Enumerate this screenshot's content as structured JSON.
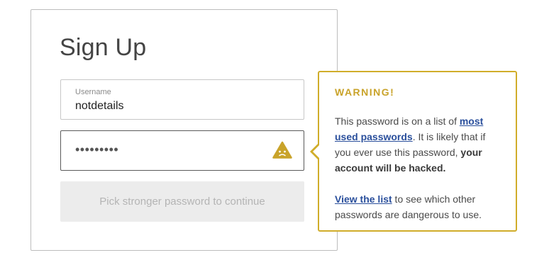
{
  "form": {
    "title": "Sign Up",
    "username": {
      "label": "Username",
      "value": "notdetails"
    },
    "password": {
      "masked_value": "•••••••••",
      "warning_icon": "warning-face-icon"
    },
    "submit_label": "Pick stronger password to continue"
  },
  "warning": {
    "heading": "WARNING!",
    "p1_before": "This password is on a list of ",
    "p1_link": "most used passwords",
    "p1_middle": ". It is likely that if you ever use this password, ",
    "p1_bold": "your account will be hacked.",
    "p2_link": "View the list",
    "p2_after": " to see which other passwords are dangerous to use."
  },
  "colors": {
    "accent": "#d0ad2a",
    "link": "#2a4f9c",
    "button_bg": "#ececec",
    "button_text": "#b4b4b4"
  }
}
